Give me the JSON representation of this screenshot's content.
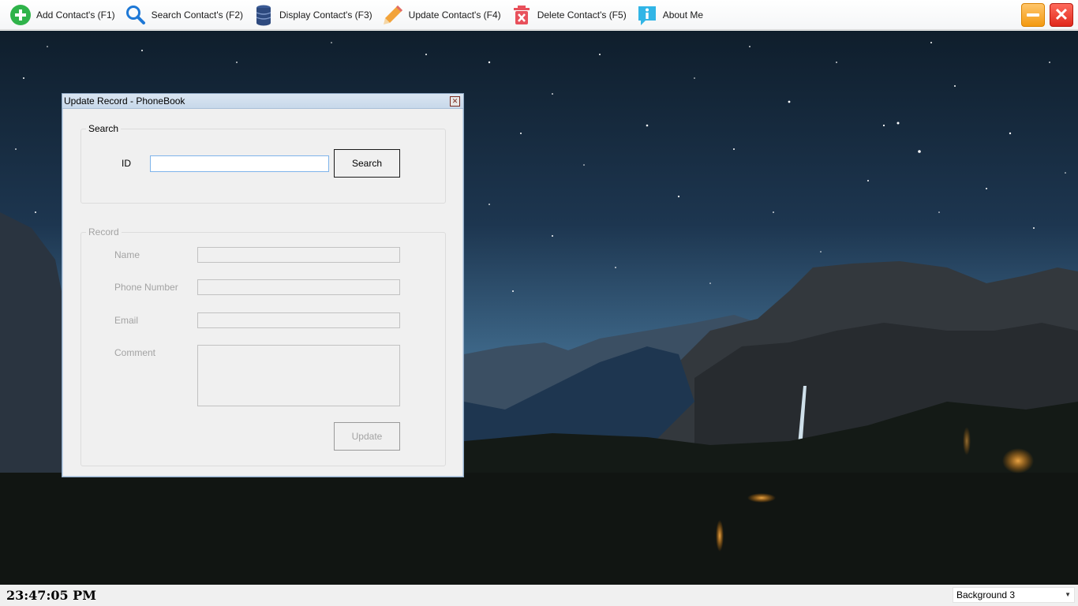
{
  "toolbar": {
    "items": [
      {
        "label": "Add Contact's (F1)",
        "icon": "add-icon"
      },
      {
        "label": "Search Contact's (F2)",
        "icon": "search-icon"
      },
      {
        "label": "Display Contact's (F3)",
        "icon": "database-icon"
      },
      {
        "label": "Update Contact's (F4)",
        "icon": "pencil-icon"
      },
      {
        "label": "Delete Contact's (F5)",
        "icon": "trash-icon"
      },
      {
        "label": "About Me",
        "icon": "info-icon"
      }
    ],
    "minimize_icon": "minimize-icon",
    "close_icon": "close-icon"
  },
  "dialog": {
    "title": "Update Record - PhoneBook",
    "search_group": {
      "legend": "Search",
      "id_label": "ID",
      "id_value": "",
      "search_button": "Search"
    },
    "record_group": {
      "legend": "Record",
      "name_label": "Name",
      "phone_label": "Phone Number",
      "email_label": "Email",
      "comment_label": "Comment",
      "update_button": "Update"
    }
  },
  "status": {
    "clock": "23:47:05 PM",
    "background_selected": "Background 3"
  },
  "colors": {
    "add": "#2fb34a",
    "search": "#1e78d6",
    "database": "#2e4a7f",
    "pencil": "#f2a33a",
    "trash": "#e8505b",
    "info": "#31b5e6"
  }
}
